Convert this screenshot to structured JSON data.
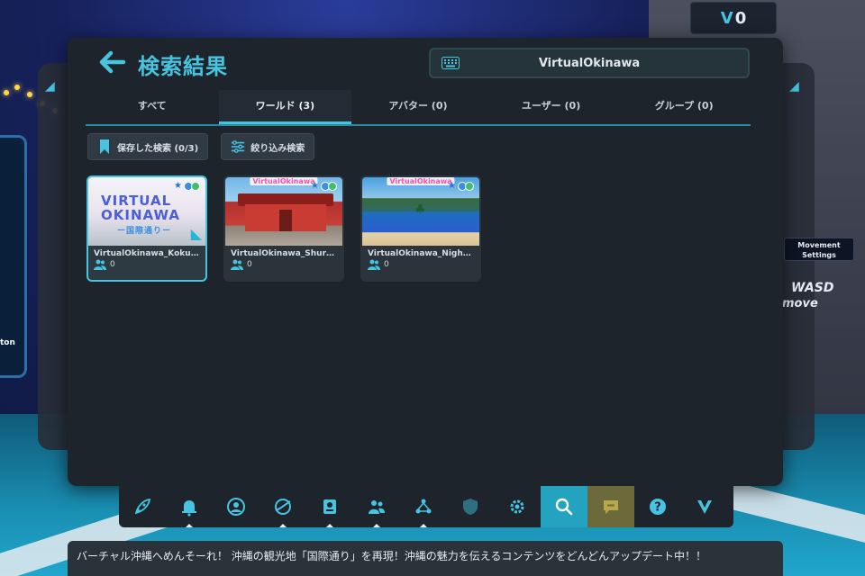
{
  "currency": {
    "amount": "0"
  },
  "header": {
    "title": "検索結果",
    "search_value": "VirtualOkinawa"
  },
  "tabs": [
    {
      "label": "すべて",
      "active": false
    },
    {
      "label": "ワールド (3)",
      "active": true
    },
    {
      "label": "アバター (0)",
      "active": false
    },
    {
      "label": "ユーザー (0)",
      "active": false
    },
    {
      "label": "グループ (0)",
      "active": false
    }
  ],
  "filters": {
    "saved_label": "保存した検索 (0/3)",
    "filter_label": "絞り込み検索"
  },
  "worlds": [
    {
      "name": "VirtualOkinawa_Kokusai",
      "users": "0",
      "thumb_title": "VIRTUAL OKINAWA",
      "thumb_sub": "ー国際通りー"
    },
    {
      "name": "VirtualOkinawa_Shurijo",
      "users": "0",
      "thumb_title": "VirtualOkinawa"
    },
    {
      "name": "VirtualOkinawa_NightBeach",
      "users": "0",
      "thumb_title": "VirtualOkinawa"
    }
  ],
  "side": {
    "movement_label": "Movement Settings",
    "wasd": "WASD",
    "move": "move",
    "left_label": "ton"
  },
  "dock": [
    {
      "icon": "rocket-icon"
    },
    {
      "icon": "bell-icon"
    },
    {
      "icon": "user-profile-icon"
    },
    {
      "icon": "worlds-icon"
    },
    {
      "icon": "avatar-icon"
    },
    {
      "icon": "social-icon"
    },
    {
      "icon": "groups-icon"
    },
    {
      "icon": "safety-icon"
    },
    {
      "icon": "settings-icon"
    },
    {
      "icon": "search-icon",
      "active": true
    },
    {
      "icon": "message-icon"
    },
    {
      "icon": "help-icon"
    },
    {
      "icon": "vrchat-plus-icon"
    }
  ],
  "ticker": {
    "text": "バーチャル沖縄へめんそーれ！ 沖縄の観光地「国際通り」を再現！沖縄の魅力を伝えるコンテンツをどんどんアップデート中！！"
  },
  "colors": {
    "accent": "#46c4e0",
    "panel": "#1d242c",
    "active_dock": "#23a3c0"
  }
}
